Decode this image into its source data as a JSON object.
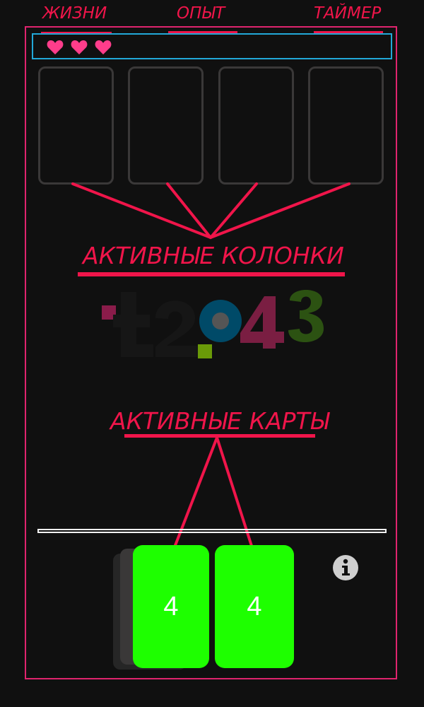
{
  "labels": {
    "lives": "ЖИЗНИ",
    "experience": "ОПЫТ",
    "timer": "ТАЙМЕР",
    "active_columns": "АКТИВНЫЕ КОЛОНКИ",
    "active_cards": "АКТИВНЫЕ КАРТЫ"
  },
  "lives": {
    "count": 3,
    "icon": "heart-icon",
    "color": "#ff3d8b"
  },
  "logo": {
    "text": "t2048"
  },
  "cards": [
    {
      "value": "4"
    },
    {
      "value": "4"
    }
  ],
  "colors": {
    "annotation": "#f0154a",
    "frame": "#e0246e",
    "status_bar_border": "#22a8d8",
    "card": "#1eff00",
    "background": "#101010"
  },
  "info_button": {
    "icon": "info-icon"
  }
}
